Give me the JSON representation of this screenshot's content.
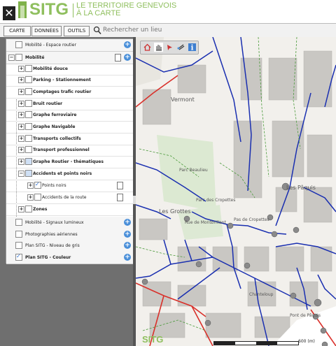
{
  "header": {
    "close_label": "✕",
    "logo": "SITG",
    "tagline_line1": "LE TERRITOIRE GENEVOIS",
    "tagline_line2": "À LA CARTE"
  },
  "toolbar": {
    "tabs": [
      "CARTE",
      "DONNÉES",
      "OUTILS"
    ],
    "search_placeholder": "Rechercher un lieu"
  },
  "layers": [
    {
      "label": "Mobilité - Espace routier",
      "level": 0,
      "checked": false,
      "expander": "",
      "plus": true
    },
    {
      "label": "Mobilité",
      "level": 0,
      "checked": false,
      "expander": "−",
      "plus": true,
      "doc": true
    },
    {
      "label": "Mobilité douce",
      "level": 1,
      "checked": false,
      "expander": "+"
    },
    {
      "label": "Parking - Stationnement",
      "level": 1,
      "checked": false,
      "expander": "+"
    },
    {
      "label": "Comptages trafic routier",
      "level": 1,
      "checked": false,
      "expander": "+"
    },
    {
      "label": "Bruit routier",
      "level": 1,
      "checked": false,
      "expander": "+"
    },
    {
      "label": "Graphe ferroviaire",
      "level": 1,
      "checked": false,
      "expander": "+"
    },
    {
      "label": "Graphe Navigable",
      "level": 1,
      "checked": false,
      "expander": "+"
    },
    {
      "label": "Transports collectifs",
      "level": 1,
      "checked": false,
      "expander": "+"
    },
    {
      "label": "Transport professionnel",
      "level": 1,
      "checked": false,
      "expander": "+"
    },
    {
      "label": "Graphe Routier - thématiques",
      "level": 1,
      "checked": true,
      "expander": "+"
    },
    {
      "label": "Accidents et points noirs",
      "level": 1,
      "checked": true,
      "expander": "−"
    },
    {
      "label": "Points noirs",
      "level": 2,
      "checked": true,
      "expander": "+",
      "doc": true
    },
    {
      "label": "Accidents de la route",
      "level": 2,
      "checked": false,
      "expander": "+",
      "doc": true
    },
    {
      "label": "Zones",
      "level": 1,
      "checked": false,
      "expander": "+"
    },
    {
      "label": "Mobilité - Signaux lumineux",
      "level": 0,
      "checked": false,
      "expander": "",
      "plus": true
    },
    {
      "label": "Photographies aériennes",
      "level": 0,
      "checked": false,
      "expander": "",
      "plus": true
    },
    {
      "label": "Plan SITG - Niveau de gris",
      "level": 0,
      "checked": false,
      "expander": "",
      "plus": true
    },
    {
      "label": "Plan SITG - Couleur",
      "level": 0,
      "checked": true,
      "expander": "",
      "plus": true
    }
  ],
  "map": {
    "tools": [
      "home-icon",
      "pan-icon",
      "select-icon",
      "measure-icon",
      "info-icon"
    ],
    "labels": [
      "Vermont",
      "Parc Beaulieu",
      "Parc des Cropettes",
      "Les Grottes",
      "Les Pâquis"
    ],
    "small_labels": [
      "Rue de Montbrillant",
      "Pas de Cropettes",
      "Chanteloup",
      "Pont de Pâquis"
    ],
    "bottom_logo": "SITG",
    "scale": "600 (m)"
  }
}
